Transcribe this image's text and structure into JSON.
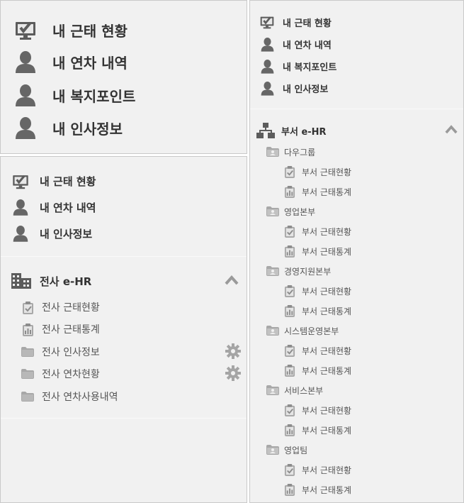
{
  "panel_a": {
    "items": [
      {
        "label": "내 근태 현황",
        "icon": "check-monitor-icon"
      },
      {
        "label": "내 연차 내역",
        "icon": "person-icon"
      },
      {
        "label": "내 복지포인트",
        "icon": "person-icon"
      },
      {
        "label": "내 인사정보",
        "icon": "person-icon"
      }
    ]
  },
  "panel_b": {
    "items": [
      {
        "label": "내 근태 현황",
        "icon": "check-monitor-icon"
      },
      {
        "label": "내 연차 내역",
        "icon": "person-icon"
      },
      {
        "label": "내 인사정보",
        "icon": "person-icon"
      }
    ],
    "section": {
      "title": "전사 e-HR",
      "icon": "building-icon",
      "items": [
        {
          "label": "전사 근태현황",
          "icon": "clipboard-check-icon",
          "gear": false
        },
        {
          "label": "전사 근태통계",
          "icon": "bar-chart-icon",
          "gear": false
        },
        {
          "label": "전사 인사정보",
          "icon": "folder-icon",
          "gear": true
        },
        {
          "label": "전사 연차현황",
          "icon": "folder-icon",
          "gear": true
        },
        {
          "label": "전사 연차사용내역",
          "icon": "folder-icon",
          "gear": false
        }
      ]
    }
  },
  "panel_c": {
    "items": [
      {
        "label": "내 근태 현황",
        "icon": "check-monitor-icon"
      },
      {
        "label": "내 연차 내역",
        "icon": "person-icon"
      },
      {
        "label": "내 복지포인트",
        "icon": "person-icon"
      },
      {
        "label": "내 인사정보",
        "icon": "person-icon"
      }
    ],
    "section": {
      "title": "부서 e-HR",
      "icon": "org-chart-icon",
      "groups": [
        {
          "name": "다우그룹",
          "items": [
            "부서 근태현황",
            "부서 근태통계"
          ]
        },
        {
          "name": "영업본부",
          "items": [
            "부서 근태현황",
            "부서 근태통계"
          ]
        },
        {
          "name": "경영지원본부",
          "items": [
            "부서 근태현황",
            "부서 근태통계"
          ]
        },
        {
          "name": "시스템운영본부",
          "items": [
            "부서 근태현황",
            "부서 근태통계"
          ]
        },
        {
          "name": "서비스본부",
          "items": [
            "부서 근태현황",
            "부서 근태통계"
          ]
        },
        {
          "name": "영업팀",
          "items": [
            "부서 근태현황",
            "부서 근태통계"
          ]
        }
      ]
    }
  },
  "colors": {
    "panel_bg": "#f1f1f1",
    "border": "#c9c9c9",
    "text": "#333333",
    "icon_dark": "#5a5a5a",
    "icon_light": "#a3a3a3"
  }
}
